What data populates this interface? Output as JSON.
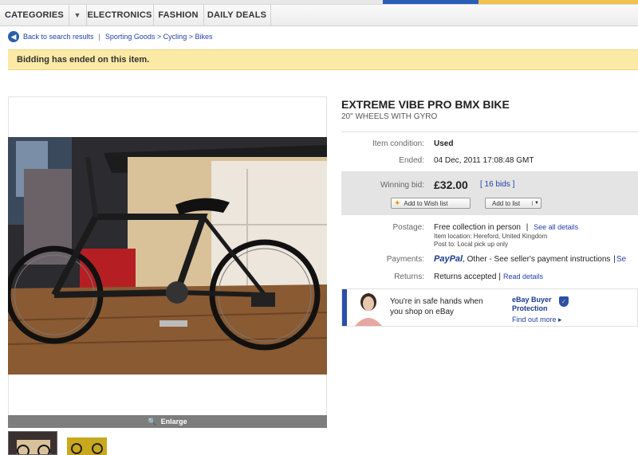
{
  "nav": {
    "categories": "CATEGORIES",
    "electronics": "ELECTRONICS",
    "fashion": "FASHION",
    "daily_deals": "DAILY DEALS"
  },
  "breadcrumb": {
    "back": "Back to search results",
    "sep": "|",
    "path": "Sporting Goods > Cycling > Bikes"
  },
  "banner": "Bidding has ended on this item.",
  "gallery": {
    "enlarge": "Enlarge"
  },
  "item": {
    "title": "EXTREME VIBE PRO BMX BIKE",
    "subtitle": "20\" WHEELS WITH GYRO",
    "condition_label": "Item condition:",
    "condition": "Used",
    "ended_label": "Ended:",
    "ended": "04 Dec, 2011 17:08:48 GMT",
    "winning_label": "Winning bid:",
    "price": "£32.00",
    "bids": "[ 16 bids ]",
    "wish_list": "Add to Wish list",
    "add_list": "Add to list"
  },
  "postage": {
    "label": "Postage:",
    "value": "Free collection in person",
    "sep": "|",
    "details_link": "See all details",
    "location": "Item location: Hereford, United Kingdom",
    "post_to": "Post to: Local pick up only"
  },
  "payments": {
    "label": "Payments:",
    "paypal": "PayPal",
    "other": ", Other - See seller's payment instructions",
    "sep": "|",
    "more": "Se"
  },
  "returns": {
    "label": "Returns:",
    "value": "Returns accepted",
    "sep": "|",
    "details_link": "Read details"
  },
  "safe": {
    "line1": "You're in safe hands when",
    "line2": "you shop on eBay",
    "protect1": "eBay Buyer",
    "protect2": "Protection",
    "find_out": "Find out more ▸"
  },
  "colors": {
    "accent_blue": "#2a4fa8",
    "link_blue": "#2440a8",
    "banner_yellow": "#fbe9a6",
    "bid_gray": "#e4e4e4"
  },
  "icons": [
    "back-arrow-icon",
    "caret-down-icon",
    "magnifier-icon",
    "star-icon",
    "shield-icon"
  ]
}
